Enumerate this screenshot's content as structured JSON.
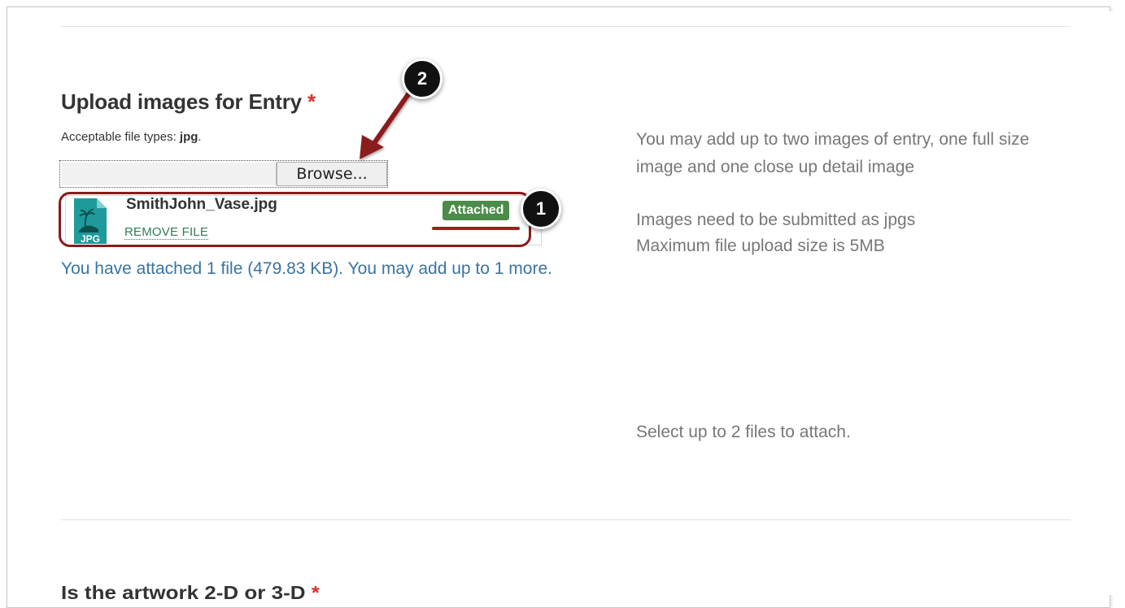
{
  "section": {
    "heading": "Upload images for Entry",
    "required_mark": "*",
    "filetypes_prefix": "Acceptable file types: ",
    "filetypes_value": "jpg",
    "filetypes_suffix": "."
  },
  "file_input": {
    "browse_label": "Browse..."
  },
  "attached_file": {
    "name": "SmithJohn_Vase.jpg",
    "icon_label": "JPG",
    "remove_label": "REMOVE FILE",
    "status_badge": "Attached"
  },
  "summary": {
    "text": "You have attached 1 file (479.83 KB). You may add up to 1 more."
  },
  "help": {
    "line1": "You may add up to two images of entry, one full size image and one close up detail image",
    "line2a": "Images need to be submitted as jpgs",
    "line2b": "Maximum file upload size is 5MB",
    "line3": "Select up to 2 files to attach."
  },
  "next_section": {
    "heading": "Is the artwork 2-D or 3-D",
    "required_mark": "*"
  },
  "annotations": {
    "callout1": "1",
    "callout2": "2",
    "color": "#8b1a1a"
  },
  "colors": {
    "badge": "#4a8c48",
    "link": "#2e7d4f",
    "summary": "#3a74a0",
    "help_text": "#777777",
    "required": "#d9302c"
  }
}
